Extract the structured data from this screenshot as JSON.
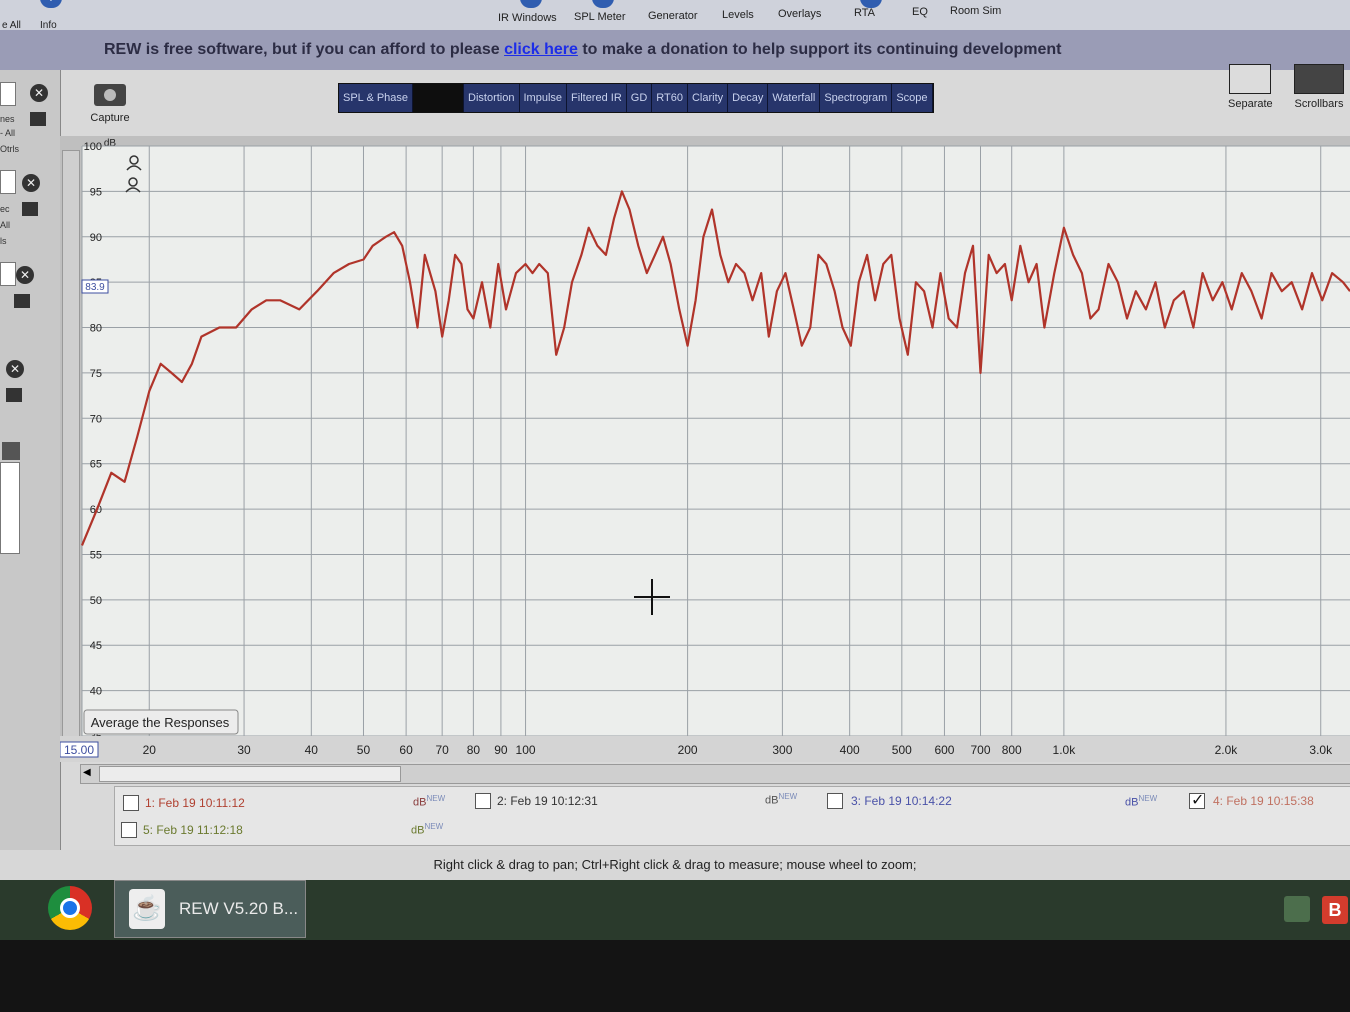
{
  "toolbar": {
    "left_labels": [
      "e All",
      "Info"
    ],
    "items": [
      "IR Windows",
      "SPL Meter",
      "Generator",
      "Levels",
      "Overlays",
      "RTA",
      "EQ",
      "Room Sim"
    ]
  },
  "banner": {
    "prefix": "REW is free software, but if you can afford to please ",
    "link": "click here",
    "suffix": " to make a donation to help support its continuing development"
  },
  "capture_label": "Capture",
  "tabs": [
    "SPL & Phase",
    "",
    "Distortion",
    "Impulse",
    "Filtered IR",
    "GD",
    "RT60",
    "Clarity",
    "Decay",
    "Waterfall",
    "Spectrogram",
    "Scope"
  ],
  "right_buttons": {
    "separate": "Separate",
    "scrollbars": "Scrollbars"
  },
  "left_strip_text": [
    "nes",
    "- All",
    "Otrls",
    "ec",
    "All",
    "ls"
  ],
  "average_button": "Average the Responses",
  "status_text": "Right click & drag to pan; Ctrl+Right click & drag to measure; mouse wheel to zoom;",
  "taskbar": {
    "app_label": "REW V5.20 B..."
  },
  "legend": [
    {
      "label": "1: Feb 19 10:11:12",
      "checked": false,
      "unit": "dB",
      "sup": "NEW"
    },
    {
      "label": "2: Feb 19 10:12:31",
      "checked": false,
      "unit": "dB",
      "sup": "NEW"
    },
    {
      "label": "3: Feb 19 10:14:22",
      "checked": false,
      "unit": "dB",
      "sup": "NEW"
    },
    {
      "label": "4: Feb 19 10:15:38",
      "checked": true,
      "unit": "",
      "sup": ""
    },
    {
      "label": "5: Feb 19 11:12:18",
      "checked": false,
      "unit": "dB",
      "sup": "NEW"
    }
  ],
  "colors": {
    "trace": "#b0342a",
    "grid": "#9aa0a6",
    "plot_bg": "#eceeec",
    "banner": "#9a9cb6"
  },
  "chart_data": {
    "type": "line",
    "ylabel": "dB",
    "xscale": "log",
    "xlim": [
      15,
      3400
    ],
    "ylim": [
      35,
      100
    ],
    "y_ticks": [
      100,
      95,
      90,
      85,
      80,
      75,
      70,
      65,
      60,
      55,
      50,
      45,
      40,
      35
    ],
    "x_ticks": [
      "15.00",
      "20",
      "30",
      "40",
      "50",
      "60",
      "70",
      "80",
      "90",
      "100",
      "200",
      "300",
      "400",
      "500",
      "600",
      "700",
      "800",
      "1.0k",
      "2.0k",
      "3.0k"
    ],
    "x_tick_values": [
      15,
      20,
      30,
      40,
      50,
      60,
      70,
      80,
      90,
      100,
      200,
      300,
      400,
      500,
      600,
      700,
      800,
      1000,
      2000,
      3000
    ],
    "cursor_readout": "83.9",
    "series": [
      {
        "x": [
          15,
          16,
          17,
          18,
          19,
          20,
          21,
          22,
          23,
          24,
          25,
          27,
          29,
          31,
          33,
          35,
          38,
          41,
          44,
          47,
          50,
          52,
          55,
          57,
          59,
          61,
          63,
          65,
          68,
          70,
          72,
          74,
          76,
          78,
          80,
          83,
          86,
          89,
          92,
          96,
          100,
          103,
          106,
          110,
          114,
          118,
          122,
          127,
          131,
          136,
          141,
          146,
          151,
          156,
          162,
          168,
          174,
          180,
          186,
          193,
          200,
          207,
          214,
          222,
          230,
          238,
          246,
          255,
          264,
          274,
          283,
          293,
          304,
          315,
          326,
          338,
          350,
          362,
          375,
          388,
          402,
          416,
          431,
          446,
          462,
          478,
          495,
          513,
          531,
          550,
          570,
          590,
          611,
          633,
          655,
          678,
          700,
          725,
          750,
          777,
          800,
          830,
          860,
          890,
          920,
          960,
          1000,
          1040,
          1080,
          1120,
          1160,
          1210,
          1260,
          1310,
          1360,
          1420,
          1480,
          1540,
          1600,
          1670,
          1740,
          1810,
          1890,
          1970,
          2050,
          2140,
          2230,
          2330,
          2430,
          2540,
          2650,
          2770,
          2890,
          3020,
          3150,
          3300,
          3400
        ],
        "y": [
          56,
          60,
          64,
          63,
          68,
          73,
          76,
          75,
          74,
          76,
          79,
          80,
          80,
          82,
          83,
          83,
          82,
          84,
          86,
          87,
          87.5,
          89,
          90,
          90.5,
          89,
          85,
          80,
          88,
          84,
          79,
          83,
          88,
          87,
          82,
          81,
          85,
          80,
          87,
          82,
          86,
          87,
          86,
          87,
          86,
          77,
          80,
          85,
          88,
          91,
          89,
          88,
          92,
          95,
          93,
          89,
          86,
          88,
          90,
          87,
          82,
          78,
          83,
          90,
          93,
          88,
          85,
          87,
          86,
          83,
          86,
          79,
          84,
          86,
          82,
          78,
          80,
          88,
          87,
          84,
          80,
          78,
          85,
          88,
          83,
          87,
          88,
          81,
          77,
          85,
          84,
          80,
          86,
          81,
          80,
          86,
          89,
          75,
          88,
          86,
          87,
          83,
          89,
          85,
          87,
          80,
          86,
          91,
          88,
          86,
          81,
          82,
          87,
          85,
          81,
          84,
          82,
          85,
          80,
          83,
          84,
          80,
          86,
          83,
          85,
          82,
          86,
          84,
          81,
          86,
          84,
          85,
          82,
          86,
          83,
          86,
          85,
          84
        ]
      }
    ]
  }
}
